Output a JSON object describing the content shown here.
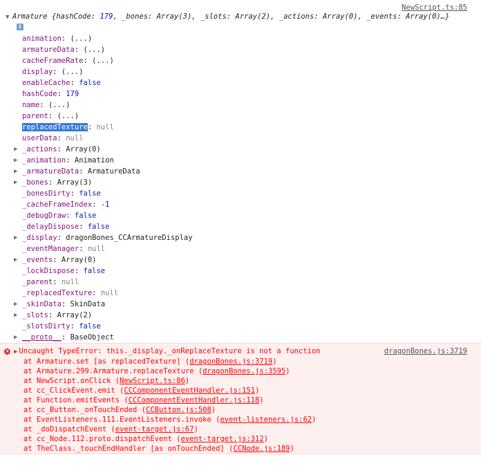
{
  "log": {
    "source_link": "NewScript.ts:85",
    "expand_glyph": "▼",
    "object_summary": {
      "class_name": "Armature",
      "open_brace": " {",
      "parts": [
        {
          "key": "hashCode",
          "value": "179"
        },
        {
          "key": "_bones",
          "value": "Array(3)"
        },
        {
          "key": "_slots",
          "value": "Array(2)"
        },
        {
          "key": "_actions",
          "value": "Array(0)"
        },
        {
          "key": "_events",
          "value": "Array(0)"
        }
      ],
      "tail": "…}"
    },
    "info_icon_glyph": "i",
    "properties": [
      {
        "name": "animation",
        "value": "(...)",
        "kind": "getter",
        "expandable": false,
        "private": false
      },
      {
        "name": "armatureData",
        "value": "(...)",
        "kind": "getter",
        "expandable": false,
        "private": false
      },
      {
        "name": "cacheFrameRate",
        "value": "(...)",
        "kind": "getter",
        "expandable": false,
        "private": false
      },
      {
        "name": "display",
        "value": "(...)",
        "kind": "getter",
        "expandable": false,
        "private": false
      },
      {
        "name": "enableCache",
        "value": "false",
        "kind": "bool",
        "expandable": false,
        "private": false
      },
      {
        "name": "hashCode",
        "value": "179",
        "kind": "num",
        "expandable": false,
        "private": false
      },
      {
        "name": "name",
        "value": "(...)",
        "kind": "getter",
        "expandable": false,
        "private": false
      },
      {
        "name": "parent",
        "value": "(...)",
        "kind": "getter",
        "expandable": false,
        "private": false
      },
      {
        "name": "replacedTexture",
        "value": "null",
        "kind": "null",
        "expandable": false,
        "private": false,
        "highlighted": true
      },
      {
        "name": "userData",
        "value": "null",
        "kind": "null",
        "expandable": false,
        "private": false
      },
      {
        "name": "_actions",
        "value": "Array(0)",
        "kind": "obj",
        "expandable": true,
        "private": false
      },
      {
        "name": "_animation",
        "value": "Animation",
        "kind": "obj",
        "expandable": true,
        "private": false
      },
      {
        "name": "_armatureData",
        "value": "ArmatureData",
        "kind": "obj",
        "expandable": true,
        "private": false
      },
      {
        "name": "_bones",
        "value": "Array(3)",
        "kind": "obj",
        "expandable": true,
        "private": false
      },
      {
        "name": "_bonesDirty",
        "value": "false",
        "kind": "bool",
        "expandable": false,
        "private": false
      },
      {
        "name": "_cacheFrameIndex",
        "value": "-1",
        "kind": "num",
        "expandable": false,
        "private": false
      },
      {
        "name": "_debugDraw",
        "value": "false",
        "kind": "bool",
        "expandable": false,
        "private": false
      },
      {
        "name": "_delayDispose",
        "value": "false",
        "kind": "bool",
        "expandable": false,
        "private": false
      },
      {
        "name": "_display",
        "value": "dragonBones_CCArmatureDisplay",
        "kind": "obj",
        "expandable": true,
        "private": false
      },
      {
        "name": "_eventManager",
        "value": "null",
        "kind": "null",
        "expandable": false,
        "private": false
      },
      {
        "name": "_events",
        "value": "Array(0)",
        "kind": "obj",
        "expandable": true,
        "private": false
      },
      {
        "name": "_lockDispose",
        "value": "false",
        "kind": "bool",
        "expandable": false,
        "private": false
      },
      {
        "name": "_parent",
        "value": "null",
        "kind": "null",
        "expandable": false,
        "private": false
      },
      {
        "name": "_replacedTexture",
        "value": "null",
        "kind": "null",
        "expandable": false,
        "private": false
      },
      {
        "name": "_skinData",
        "value": "SkinData",
        "kind": "obj",
        "expandable": true,
        "private": false
      },
      {
        "name": "_slots",
        "value": "Array(2)",
        "kind": "obj",
        "expandable": true,
        "private": false
      },
      {
        "name": "_slotsDirty",
        "value": "false",
        "kind": "bool",
        "expandable": false,
        "private": false
      },
      {
        "name": "__proto__",
        "value": "BaseObject",
        "kind": "obj",
        "expandable": true,
        "private": false,
        "proto": true
      }
    ]
  },
  "error": {
    "icon_glyph": "×",
    "expand_glyph": "▶",
    "message": "Uncaught TypeError: this._display._onReplaceTexture is not a function",
    "source_link": "dragonBones.js:3719",
    "stack": [
      {
        "fn": "at Armature.set [as replacedTexture] (",
        "link": "dragonBones.js:3719",
        "close": ")"
      },
      {
        "fn": "at Armature.299.Armature.replaceTexture (",
        "link": "dragonBones.js:3595",
        "close": ")"
      },
      {
        "fn": "at NewScript.onClick (",
        "link": "NewScript.ts:86",
        "close": ")"
      },
      {
        "fn": "at cc_ClickEvent.emit (",
        "link": "CCComponentEventHandler.js:151",
        "close": ")"
      },
      {
        "fn": "at Function.emitEvents (",
        "link": "CCComponentEventHandler.js:118",
        "close": ")"
      },
      {
        "fn": "at cc_Button._onTouchEnded (",
        "link": "CCButton.js:508",
        "close": ")"
      },
      {
        "fn": "at EventListeners.111.EventListeners.invoke (",
        "link": "event-listeners.js:62",
        "close": ")"
      },
      {
        "fn": "at _doDispatchEvent (",
        "link": "event-target.js:67",
        "close": ")"
      },
      {
        "fn": "at cc_Node.112.proto.dispatchEvent (",
        "link": "event-target.js:312",
        "close": ")"
      },
      {
        "fn": "at TheClass._touchEndHandler [as onTouchEnded] (",
        "link": "CCNode.js:189",
        "close": ")"
      }
    ]
  }
}
